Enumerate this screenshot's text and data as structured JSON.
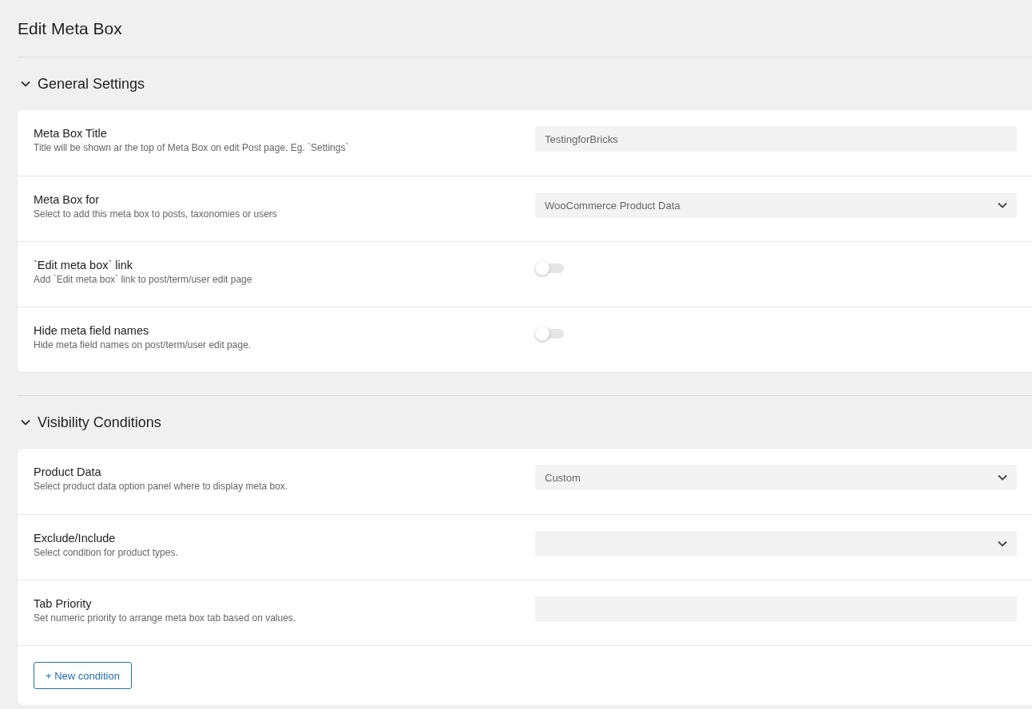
{
  "page_title": "Edit Meta Box",
  "sections": [
    {
      "title": "General Settings",
      "expanded": true,
      "rows": [
        {
          "label": "Meta Box Title",
          "description": "Title will be shown ar the top of Meta Box on edit Post page. Eg. `Settings`",
          "kind": "text",
          "value": "TestingforBricks"
        },
        {
          "label": "Meta Box for",
          "description": "Select to add this meta box to posts, taxonomies or users",
          "kind": "select",
          "value": "WooCommerce Product Data"
        },
        {
          "label": "`Edit meta box` link",
          "description": "Add `Edit meta box` link to post/term/user edit page",
          "kind": "toggle",
          "on": false
        },
        {
          "label": "Hide meta field names",
          "description": "Hide meta field names on post/term/user edit page.",
          "kind": "toggle",
          "on": false
        }
      ]
    },
    {
      "title": "Visibility Conditions",
      "expanded": true,
      "rows": [
        {
          "label": "Product Data",
          "description": "Select product data option panel where to display meta box.",
          "kind": "select",
          "value": "Custom"
        },
        {
          "label": "Exclude/Include",
          "description": "Select condition for product types.",
          "kind": "select"
        },
        {
          "label": "Tab Priority",
          "description": "Set numeric priority to arrange meta box tab based on values.",
          "kind": "text"
        }
      ],
      "button": "+ New condition"
    }
  ]
}
